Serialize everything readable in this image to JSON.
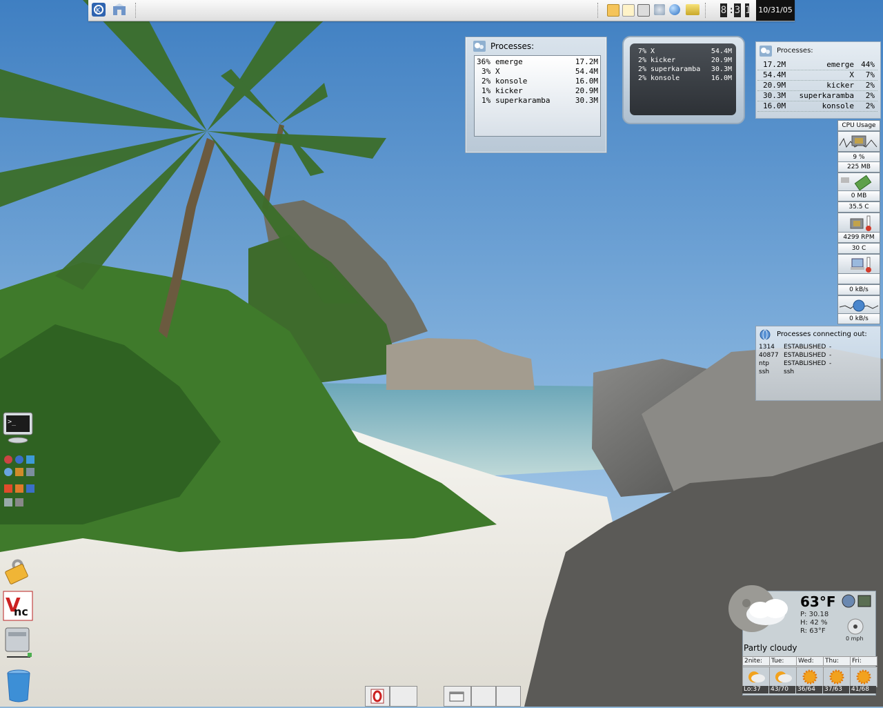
{
  "panel": {
    "date": "10/31/05",
    "clock": [
      "8",
      ":",
      "3",
      "1"
    ],
    "launchers": [
      "kde-menu-icon",
      "home-folder-icon"
    ],
    "tray": [
      "klipper-icon",
      "kontact-icon",
      "printer-icon",
      "volume-icon",
      "network-icon",
      "battery-icon"
    ]
  },
  "proc_widget_1": {
    "title": "Processes:",
    "rows": [
      {
        "pct": "36%",
        "name": "emerge",
        "mem": "17.2M"
      },
      {
        "pct": "3%",
        "name": "X",
        "mem": "54.4M"
      },
      {
        "pct": "2%",
        "name": "konsole",
        "mem": "16.0M"
      },
      {
        "pct": "1%",
        "name": "kicker",
        "mem": "20.9M"
      },
      {
        "pct": "1%",
        "name": "superkaramba",
        "mem": "30.3M"
      }
    ]
  },
  "proc_widget_2": {
    "rows": [
      {
        "pct": "7%",
        "name": "X",
        "mem": "54.4M"
      },
      {
        "pct": "2%",
        "name": "kicker",
        "mem": "20.9M"
      },
      {
        "pct": "2%",
        "name": "superkaramba",
        "mem": "30.3M"
      },
      {
        "pct": "2%",
        "name": "konsole",
        "mem": "16.0M"
      }
    ]
  },
  "proc_widget_3": {
    "title": "Processes:",
    "rows": [
      {
        "mem": "17.2M",
        "name": "emerge",
        "pct": "44%"
      },
      {
        "mem": "54.4M",
        "name": "X",
        "pct": "7%"
      },
      {
        "mem": "20.9M",
        "name": "kicker",
        "pct": "2%"
      },
      {
        "mem": "30.3M",
        "name": "superkaramba",
        "pct": "2%"
      },
      {
        "mem": "16.0M",
        "name": "konsole",
        "pct": "2%"
      }
    ]
  },
  "sysmon": {
    "cpu_title": "CPU Usage",
    "cpu_value": "9 %",
    "mem_used": "225 MB",
    "swap_used": "0 MB",
    "cpu_temp": "35.5 C",
    "fan_speed": "4299 RPM",
    "sys_temp": "30 C",
    "net_up": "0 kB/s",
    "net_down": "0 kB/s"
  },
  "connections": {
    "title": "Processes connecting out:",
    "rows": [
      {
        "pid": "1314",
        "state": "ESTABLISHED",
        "name": "-"
      },
      {
        "pid": "40877",
        "state": "ESTABLISHED",
        "name": "-"
      },
      {
        "pid": "ntp",
        "state": "ESTABLISHED",
        "name": "-"
      },
      {
        "pid": "ssh",
        "state": "ssh",
        "name": ""
      }
    ]
  },
  "weather": {
    "temp": "63°F",
    "pressure": "P: 30.18",
    "humidity": "H: 42 %",
    "realfeel": "R: 63°F",
    "wind": "0 mph",
    "condition": "Partly cloudy",
    "forecast": [
      {
        "day": "2nite:",
        "range": "Lo:37"
      },
      {
        "day": "Tue:",
        "range": "43/70"
      },
      {
        "day": "Wed:",
        "range": "36/64"
      },
      {
        "day": "Thu:",
        "range": "37/63"
      },
      {
        "day": "Fri:",
        "range": "41/68"
      }
    ]
  },
  "desktop_icons": [
    "terminal-icon",
    "lock-icon",
    "vnc-icon",
    "drive-icon",
    "trash-icon"
  ],
  "colors": {
    "panel": "#e8e8e8",
    "sky": "#6fa6d8",
    "sand": "#f2f0ea",
    "foliage": "#3f7a2b"
  }
}
